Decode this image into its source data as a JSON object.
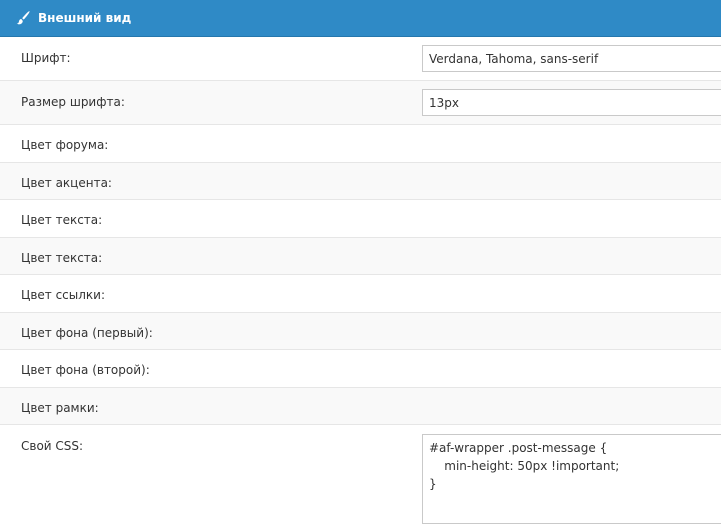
{
  "header": {
    "title": "Внешний вид",
    "icon": "paintbrush-icon"
  },
  "colors": {
    "header_bg": "#2f8ac6",
    "alt_row_bg": "#f9f9f9"
  },
  "settings": {
    "font": {
      "label": "Шрифт:",
      "value": "Verdana, Tahoma, sans-serif"
    },
    "font_size": {
      "label": "Размер шрифта:",
      "value": "13px"
    },
    "forum_color": {
      "label": "Цвет форума:"
    },
    "accent_color": {
      "label": "Цвет акцента:"
    },
    "text_color_1": {
      "label": "Цвет текста:"
    },
    "text_color_2": {
      "label": "Цвет текста:"
    },
    "link_color": {
      "label": "Цвет ссылки:"
    },
    "bg_color_first": {
      "label": "Цвет фона (первый):"
    },
    "bg_color_second": {
      "label": "Цвет фона (второй):"
    },
    "border_color": {
      "label": "Цвет рамки:"
    },
    "custom_css": {
      "label": "Свой CSS:",
      "value": "#af-wrapper .post-message {\n    min-height: 50px !important;\n}"
    }
  }
}
